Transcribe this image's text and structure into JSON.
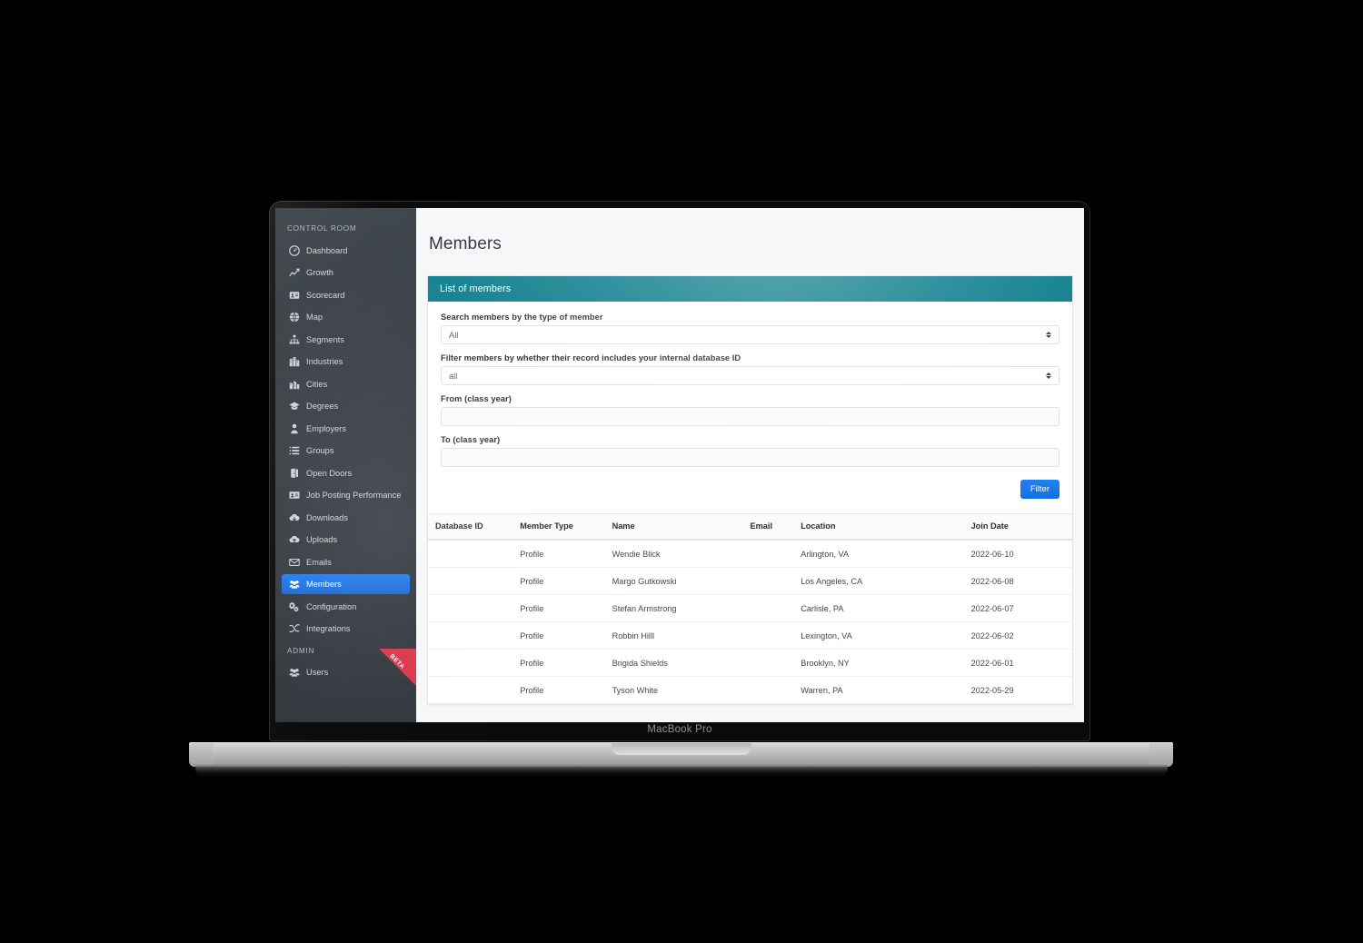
{
  "device": {
    "label": "MacBook Pro"
  },
  "sidebar": {
    "section_control_room": "CONTROL ROOM",
    "section_admin": "ADMIN",
    "beta_badge": "BETA",
    "items": [
      {
        "label": "Dashboard",
        "icon": "dashboard-icon",
        "active": false
      },
      {
        "label": "Growth",
        "icon": "chart-line-icon",
        "active": false
      },
      {
        "label": "Scorecard",
        "icon": "scorecard-icon",
        "active": false
      },
      {
        "label": "Map",
        "icon": "globe-icon",
        "active": false
      },
      {
        "label": "Segments",
        "icon": "sitemap-icon",
        "active": false
      },
      {
        "label": "Industries",
        "icon": "building-icon",
        "active": false
      },
      {
        "label": "Cities",
        "icon": "city-icon",
        "active": false
      },
      {
        "label": "Degrees",
        "icon": "graduation-icon",
        "active": false
      },
      {
        "label": "Employers",
        "icon": "user-tie-icon",
        "active": false
      },
      {
        "label": "Groups",
        "icon": "list-icon",
        "active": false
      },
      {
        "label": "Open Doors",
        "icon": "door-open-icon",
        "active": false
      },
      {
        "label": "Job Posting Performance",
        "icon": "id-card-icon",
        "active": false
      },
      {
        "label": "Downloads",
        "icon": "cloud-download-icon",
        "active": false
      },
      {
        "label": "Uploads",
        "icon": "cloud-upload-icon",
        "active": false
      },
      {
        "label": "Emails",
        "icon": "envelope-icon",
        "active": false
      },
      {
        "label": "Members",
        "icon": "users-icon",
        "active": true
      },
      {
        "label": "Configuration",
        "icon": "cogs-icon",
        "active": false
      },
      {
        "label": "Integrations",
        "icon": "shuffle-icon",
        "active": false
      }
    ],
    "admin_items": [
      {
        "label": "Users",
        "icon": "users-icon",
        "active": false
      }
    ]
  },
  "main": {
    "page_title": "Members",
    "card_header": "List of members",
    "fields": {
      "member_type": {
        "label": "Search members by the type of member",
        "value": "All",
        "control": "select"
      },
      "database_id": {
        "label": "Filter members by whether their record includes your internal database ID",
        "value": "all",
        "control": "select"
      },
      "from_class_year": {
        "label": "From (class year)",
        "value": "",
        "placeholder": "",
        "control": "text"
      },
      "to_class_year": {
        "label": "To (class year)",
        "value": "",
        "placeholder": "",
        "control": "text"
      }
    },
    "filter_button": "Filter",
    "table": {
      "columns": [
        "Database ID",
        "Member Type",
        "Name",
        "Email",
        "Location",
        "Join Date"
      ],
      "rows": [
        {
          "database_id": "",
          "member_type": "Profile",
          "name": "Wendie Blick",
          "email": "",
          "location": "Arlington, VA",
          "join_date": "2022-06-10"
        },
        {
          "database_id": "",
          "member_type": "Profile",
          "name": "Margo Gutkowski",
          "email": "",
          "location": "Los Angeles, CA",
          "join_date": "2022-06-08"
        },
        {
          "database_id": "",
          "member_type": "Profile",
          "name": "Stefan Armstrong",
          "email": "",
          "location": "Carlisle, PA",
          "join_date": "2022-06-07"
        },
        {
          "database_id": "",
          "member_type": "Profile",
          "name": "Robbin Hilll",
          "email": "",
          "location": "Lexington, VA",
          "join_date": "2022-06-02"
        },
        {
          "database_id": "",
          "member_type": "Profile",
          "name": "Brigida Shields",
          "email": "",
          "location": "Brooklyn, NY",
          "join_date": "2022-06-01"
        },
        {
          "database_id": "",
          "member_type": "Profile",
          "name": "Tyson White",
          "email": "",
          "location": "Warren, PA",
          "join_date": "2022-05-29"
        }
      ]
    }
  },
  "colors": {
    "sidebar_bg": "#343a40",
    "sidebar_active": "#1a73e8",
    "card_header_teal": "#12808f",
    "primary_button": "#1877e8",
    "ribbon_red": "#d9344a"
  }
}
